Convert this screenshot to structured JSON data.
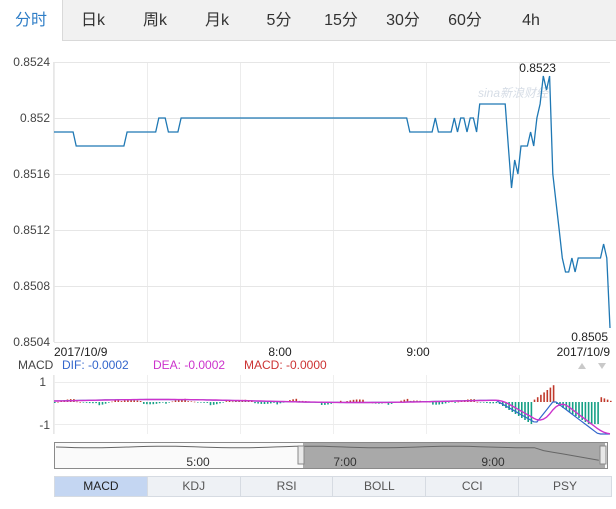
{
  "tabs": [
    {
      "label": "分时",
      "active": true
    },
    {
      "label": "日k",
      "active": false
    },
    {
      "label": "周k",
      "active": false
    },
    {
      "label": "月k",
      "active": false
    },
    {
      "label": "5分",
      "active": false
    },
    {
      "label": "15分",
      "active": false
    },
    {
      "label": "30分",
      "active": false
    },
    {
      "label": "60分",
      "active": false
    },
    {
      "label": "4h",
      "active": false
    }
  ],
  "watermark": "sina新浪财经",
  "macd_legend": {
    "name": "MACD",
    "dif": "DIF: -0.0002",
    "dea": "DEA: -0.0002",
    "macd": "MACD: -0.0000"
  },
  "colors": {
    "accent": "#2f7ec7",
    "price_line": "#1f78b4",
    "dif": "#3366cc",
    "dea": "#cc33cc",
    "macd_text": "#cc3333",
    "bar_pos": "#c0392b",
    "bar_neg": "#16a085"
  },
  "navigator": {
    "labels": [
      "5:00",
      "7:00",
      "9:00"
    ]
  },
  "indicator_tabs": [
    {
      "label": "MACD",
      "selected": true
    },
    {
      "label": "KDJ",
      "selected": false
    },
    {
      "label": "RSI",
      "selected": false
    },
    {
      "label": "BOLL",
      "selected": false
    },
    {
      "label": "CCI",
      "selected": false
    },
    {
      "label": "PSY",
      "selected": false
    }
  ],
  "chart_data": [
    {
      "type": "line",
      "title": "",
      "y_ticks": [
        "0.8524",
        "0.852",
        "0.8516",
        "0.8512",
        "0.8508",
        "0.8504"
      ],
      "ylim": [
        0.8504,
        0.8524
      ],
      "x_tick_labels": [
        "2017/10/9",
        "8:00",
        "9:00",
        "2017/10/9"
      ],
      "annotations": {
        "max": "0.8523",
        "min": "0.8505"
      },
      "series": [
        {
          "values": [
            0.8519,
            0.8519,
            0.8519,
            0.8519,
            0.8519,
            0.8519,
            0.8519,
            0.8518,
            0.8518,
            0.8518,
            0.8518,
            0.8518,
            0.8518,
            0.8518,
            0.8518,
            0.8518,
            0.8518,
            0.8518,
            0.8518,
            0.8518,
            0.8518,
            0.8518,
            0.8518,
            0.8519,
            0.8519,
            0.8519,
            0.8519,
            0.8519,
            0.8519,
            0.8519,
            0.8519,
            0.8519,
            0.8519,
            0.852,
            0.852,
            0.852,
            0.8519,
            0.8519,
            0.8519,
            0.8519,
            0.852,
            0.852,
            0.852,
            0.852,
            0.852,
            0.852,
            0.852,
            0.852,
            0.852,
            0.852,
            0.852,
            0.852,
            0.852,
            0.852,
            0.852,
            0.852,
            0.852,
            0.852,
            0.852,
            0.852,
            0.852,
            0.852,
            0.852,
            0.852,
            0.852,
            0.852,
            0.852,
            0.852,
            0.852,
            0.852,
            0.852,
            0.852,
            0.852,
            0.852,
            0.852,
            0.852,
            0.852,
            0.852,
            0.852,
            0.852,
            0.852,
            0.852,
            0.852,
            0.852,
            0.852,
            0.852,
            0.852,
            0.852,
            0.852,
            0.852,
            0.852,
            0.852,
            0.852,
            0.852,
            0.852,
            0.852,
            0.852,
            0.852,
            0.852,
            0.852,
            0.852,
            0.852,
            0.852,
            0.852,
            0.852,
            0.852,
            0.852,
            0.852,
            0.852,
            0.852,
            0.852,
            0.852,
            0.8519,
            0.8519,
            0.8519,
            0.8519,
            0.8519,
            0.8519,
            0.8519,
            0.8519,
            0.852,
            0.8519,
            0.8519,
            0.8519,
            0.8519,
            0.8519,
            0.852,
            0.8519,
            0.852,
            0.852,
            0.8519,
            0.852,
            0.852,
            0.8519,
            0.8521,
            0.8521,
            0.8521,
            0.8521,
            0.8521,
            0.8521,
            0.8521,
            0.8521,
            0.8521,
            0.8518,
            0.8515,
            0.8517,
            0.8516,
            0.8518,
            0.8518,
            0.8518,
            0.8519,
            0.8518,
            0.852,
            0.8521,
            0.8523,
            0.8522,
            0.8523,
            0.8516,
            0.8514,
            0.8512,
            0.851,
            0.8509,
            0.8509,
            0.851,
            0.8509,
            0.851,
            0.851,
            0.851,
            0.851,
            0.851,
            0.851,
            0.851,
            0.851,
            0.8511,
            0.851,
            0.8505
          ]
        }
      ]
    },
    {
      "type": "bar",
      "title": "MACD",
      "y_ticks": [
        "1",
        "-1"
      ],
      "ylim": [
        -1.5,
        1.5
      ]
    }
  ]
}
